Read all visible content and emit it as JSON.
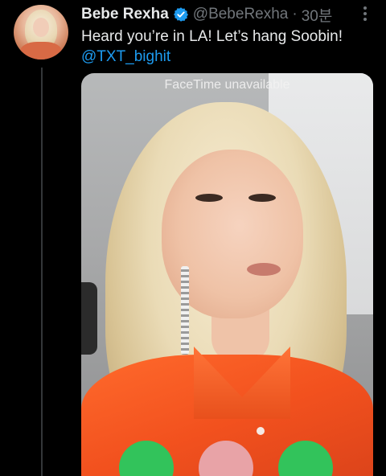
{
  "tweet": {
    "author_name": "Bebe Rexha",
    "handle": "@BebeRexha",
    "separator": "·",
    "time": "30분",
    "text_line": "Heard you’re in LA! Let’s hang Soobin!",
    "mention": "@TXT_bighit"
  },
  "media": {
    "overlay_text": "FaceTime unavailable"
  },
  "colors": {
    "background": "#000000",
    "text": "#e7e9ea",
    "muted": "#71767b",
    "link": "#1d9bf0",
    "verified": "#1d9bf0",
    "accept": "#32c35b",
    "decline": "#e8a3a7"
  },
  "icons": {
    "verified": "verified-badge-icon",
    "more": "more-options-icon"
  }
}
